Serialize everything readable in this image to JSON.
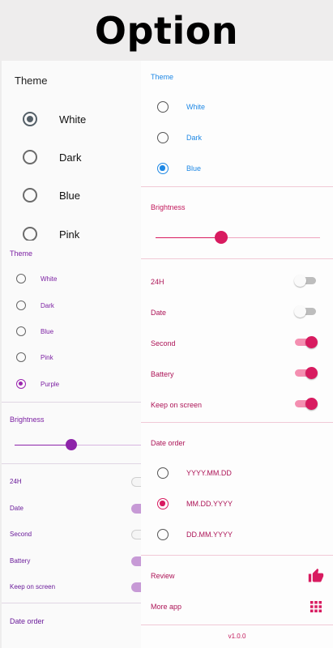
{
  "header": {
    "title": "Option"
  },
  "panel_white": {
    "theme_title": "Theme",
    "options": [
      "White",
      "Dark",
      "Blue",
      "Pink"
    ],
    "selected": "White"
  },
  "panel_purple": {
    "theme_title": "Theme",
    "options": [
      "White",
      "Dark",
      "Blue",
      "Pink",
      "Purple"
    ],
    "selected": "Purple",
    "brightness_title": "Brightness",
    "brightness_value": 0.45,
    "switches": [
      {
        "label": "24H",
        "on": false
      },
      {
        "label": "Date",
        "on": true
      },
      {
        "label": "Second",
        "on": false
      },
      {
        "label": "Battery",
        "on": true
      },
      {
        "label": "Keep on screen",
        "on": true
      }
    ],
    "date_order_title": "Date order",
    "accent": "#9c27b0"
  },
  "panel_pink": {
    "theme_title": "Theme",
    "options": [
      "White",
      "Dark",
      "Blue"
    ],
    "selected": "Blue",
    "brightness_title": "Brightness",
    "brightness_value": 0.4,
    "switches": [
      {
        "label": "24H",
        "on": false
      },
      {
        "label": "Date",
        "on": false
      },
      {
        "label": "Second",
        "on": true
      },
      {
        "label": "Battery",
        "on": true
      },
      {
        "label": "Keep on screen",
        "on": true
      }
    ],
    "date_order_title": "Date order",
    "date_orders": [
      "YYYY.MM.DD",
      "MM.DD.YYYY",
      "DD.MM.YYYY"
    ],
    "date_order_selected": "MM.DD.YYYY",
    "review_label": "Review",
    "more_app_label": "More app",
    "version": "v1.0.0",
    "accent": "#d81b60",
    "theme_accent": "#1e88e5"
  }
}
